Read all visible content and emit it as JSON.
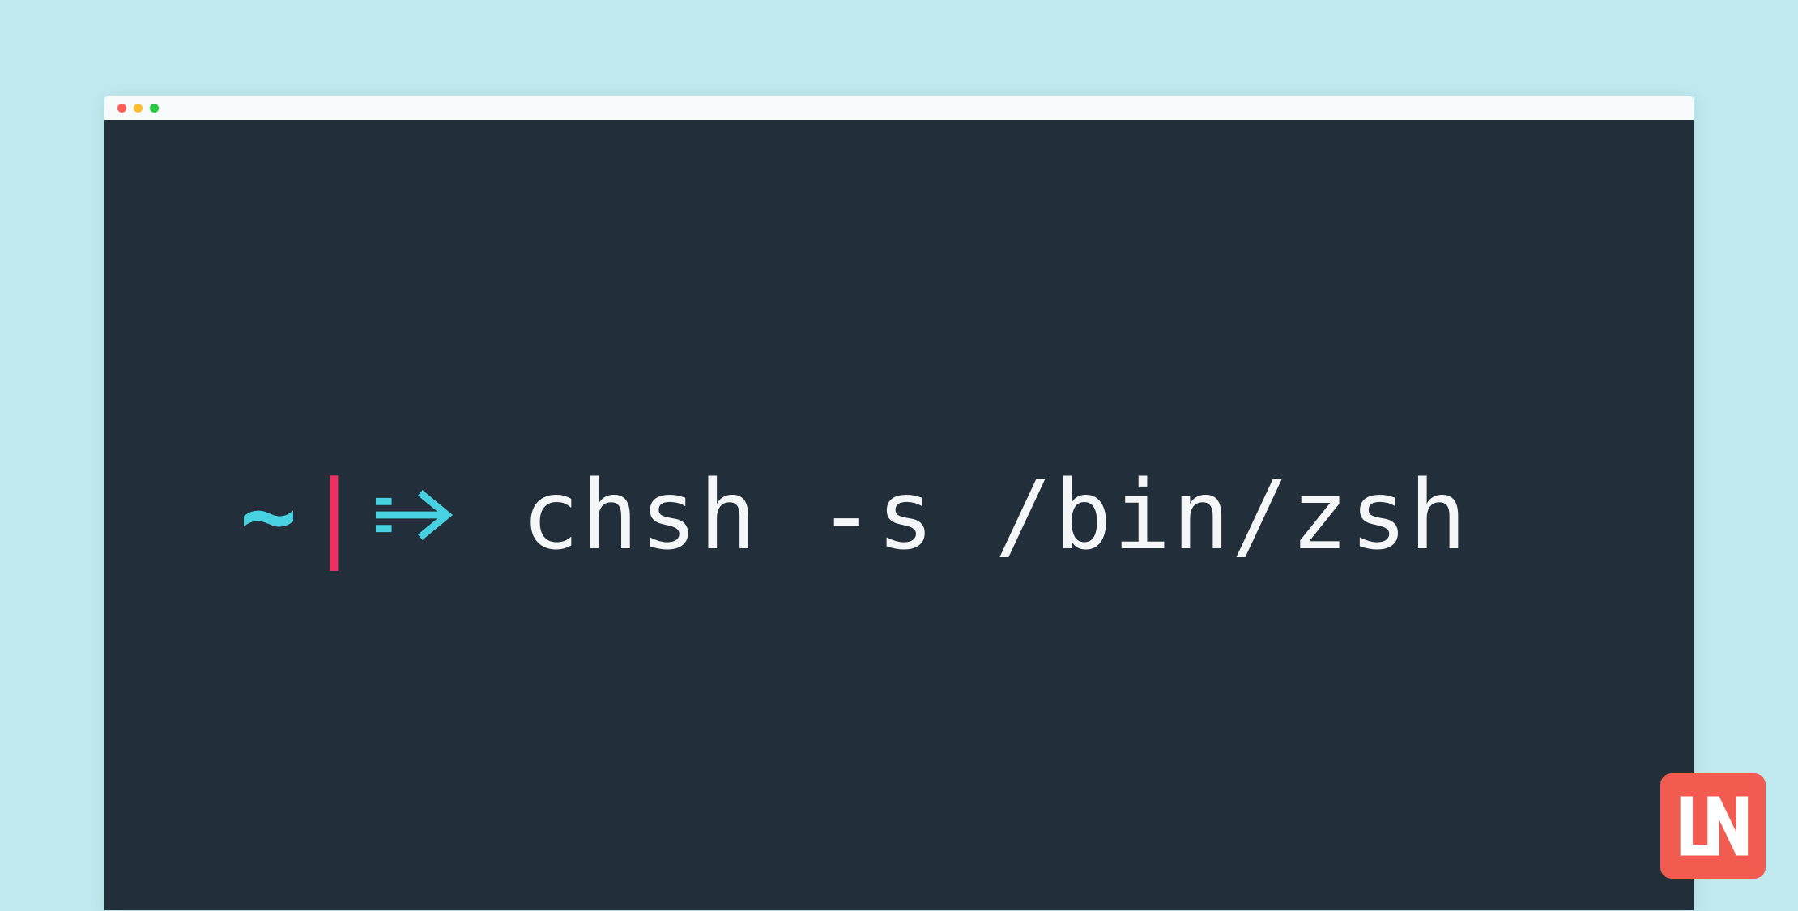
{
  "terminal": {
    "prompt": {
      "cwd_symbol": "~",
      "separator": "|",
      "arrow": "⇒"
    },
    "command": "chsh -s /bin/zsh"
  },
  "logo": {
    "text": "LN"
  },
  "colors": {
    "page_bg": "#bfe9ee",
    "terminal_bg": "#222f3a",
    "titlebar_bg": "#f8fbfc",
    "prompt_cyan": "#48d1e0",
    "prompt_pink": "#ef2e62",
    "command_text": "#f4f6f7",
    "logo_bg": "#f15b50"
  }
}
